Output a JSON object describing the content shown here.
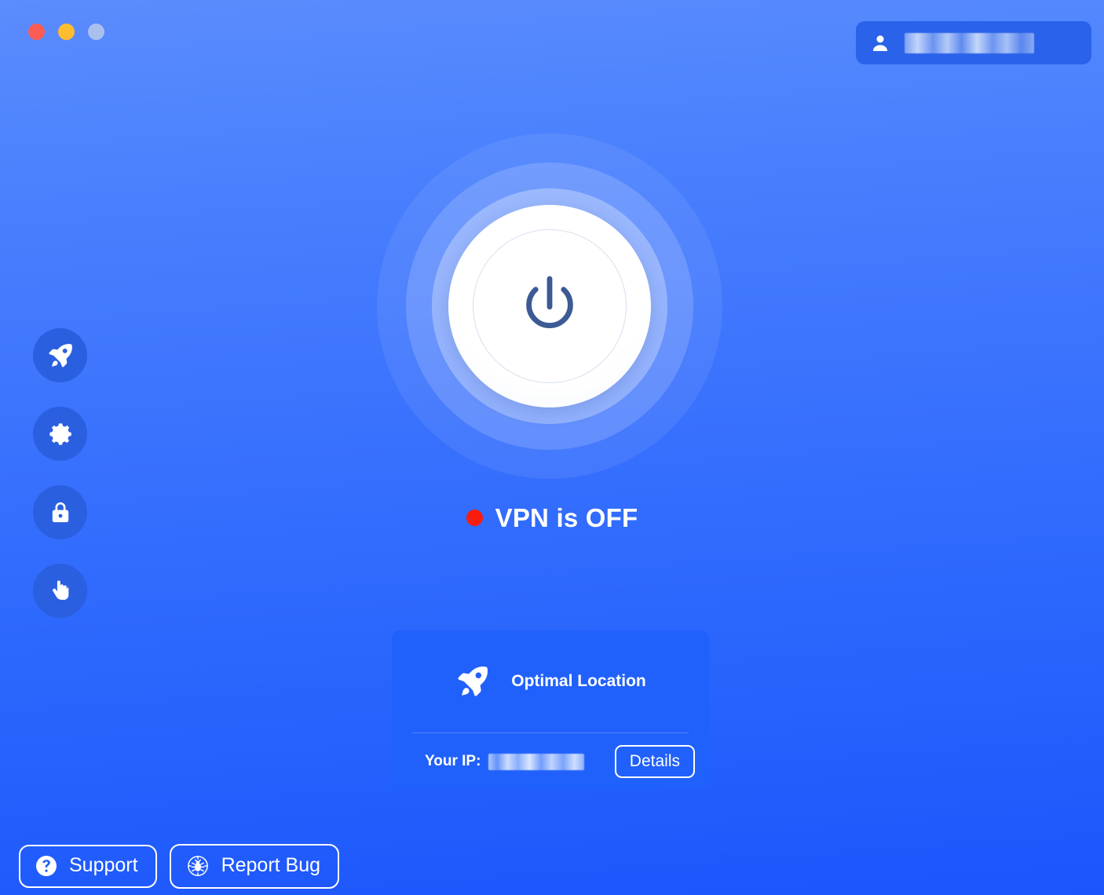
{
  "window": {
    "traffic_lights": [
      {
        "name": "close",
        "color": "#fb5c54"
      },
      {
        "name": "minimize",
        "color": "#fdbd2e"
      },
      {
        "name": "zoom",
        "color": "#a9c0ee"
      }
    ]
  },
  "account": {
    "icon": "person-icon",
    "username": "",
    "username_redacted": true
  },
  "sidebar": {
    "items": [
      {
        "icon": "rocket-icon",
        "name": "locations"
      },
      {
        "icon": "gear-icon",
        "name": "settings"
      },
      {
        "icon": "lock-icon",
        "name": "security"
      },
      {
        "icon": "hand-icon",
        "name": "block"
      }
    ]
  },
  "main": {
    "power_button": {
      "icon": "power-icon",
      "state": "off"
    },
    "status": {
      "text": "VPN is OFF",
      "dot_color": "#f91c0d"
    },
    "location_card": {
      "icon": "rocket-icon",
      "label": "Optimal Location",
      "ip_label": "Your IP:",
      "ip_value": "",
      "ip_redacted": true,
      "details_label": "Details"
    }
  },
  "footer": {
    "support": {
      "icon": "question-circle-icon",
      "label": "Support"
    },
    "report_bug": {
      "icon": "bug-icon",
      "label": "Report Bug"
    }
  },
  "theme": {
    "bg_top": "#5c8cfd",
    "bg_bottom": "#1c55fc",
    "accent_pill": "#2a62e9",
    "card_bg": "#2161fb",
    "side_icon_bg": "#2a5fe0",
    "power_glyph": "#38558f",
    "white": "#ffffff"
  }
}
